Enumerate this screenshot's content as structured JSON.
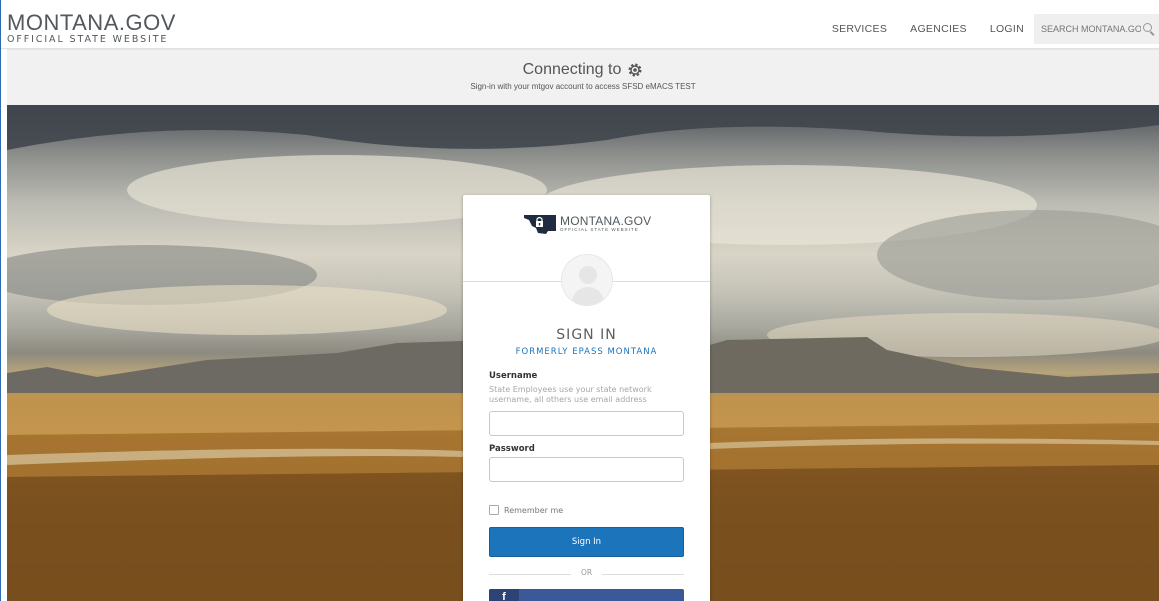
{
  "header": {
    "brand_name": "MONTANA.GOV",
    "brand_sub": "OFFICIAL STATE WEBSITE",
    "nav": [
      {
        "label": "SERVICES"
      },
      {
        "label": "AGENCIES"
      },
      {
        "label": "LOGIN"
      }
    ],
    "search": {
      "placeholder": "SEARCH MONTANA.GOV",
      "icon": "search-icon"
    }
  },
  "connect": {
    "title": "Connecting to",
    "subtitle": "Sign-in with your mtgov account to access SFSD eMACS TEST",
    "icon": "gear-icon"
  },
  "card": {
    "logo_main": "MONTANA.GOV",
    "logo_sub": "OFFICIAL STATE WEBSITE",
    "title": "SIGN IN",
    "subtitle": "FORMERLY EPASS MONTANA",
    "username": {
      "label": "Username",
      "help": "State Employees use your state network username, all others use email address",
      "value": ""
    },
    "password": {
      "label": "Password",
      "value": ""
    },
    "remember_label": "Remember me",
    "signin_label": "Sign In",
    "or_label": "OR",
    "facebook_icon": "f"
  },
  "colors": {
    "accent": "#1c74bb",
    "facebook": "#3b5998",
    "text": "#51595e"
  }
}
